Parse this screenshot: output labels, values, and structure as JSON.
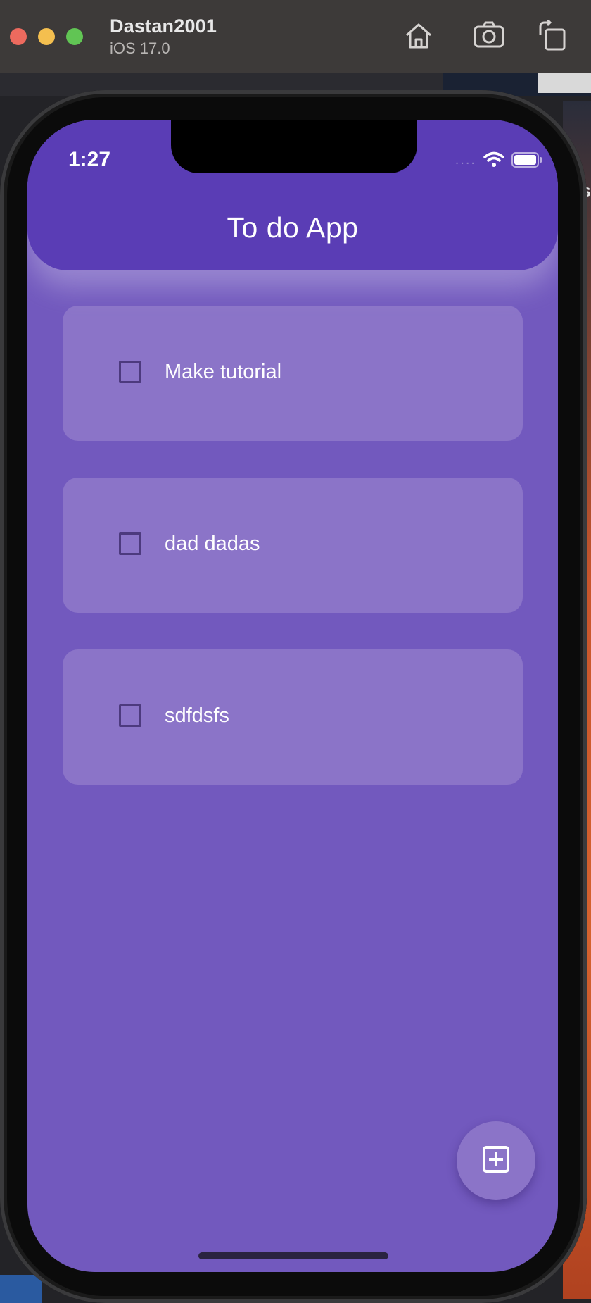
{
  "simulator": {
    "device_name": "Dastan2001",
    "os_version": "iOS 17.0",
    "buttons": [
      "home-icon",
      "screenshot-icon",
      "rotate-icon"
    ]
  },
  "desktop_edge_text": "nas",
  "status_bar": {
    "time": "1:27",
    "signal": "....",
    "icons": [
      "wifi-icon",
      "battery-icon"
    ]
  },
  "app": {
    "title": "To do App",
    "todos": [
      {
        "label": "Make tutorial",
        "checked": false
      },
      {
        "label": "dad dadas",
        "checked": false
      },
      {
        "label": "sdfdsfs",
        "checked": false
      }
    ],
    "fab_icon": "add-box-icon"
  },
  "colors": {
    "app_bar": "#5a3db5",
    "background": "#7259be",
    "card": "#8b74c8",
    "checkbox_border": "#4d3a7e",
    "text": "#ffffff"
  }
}
